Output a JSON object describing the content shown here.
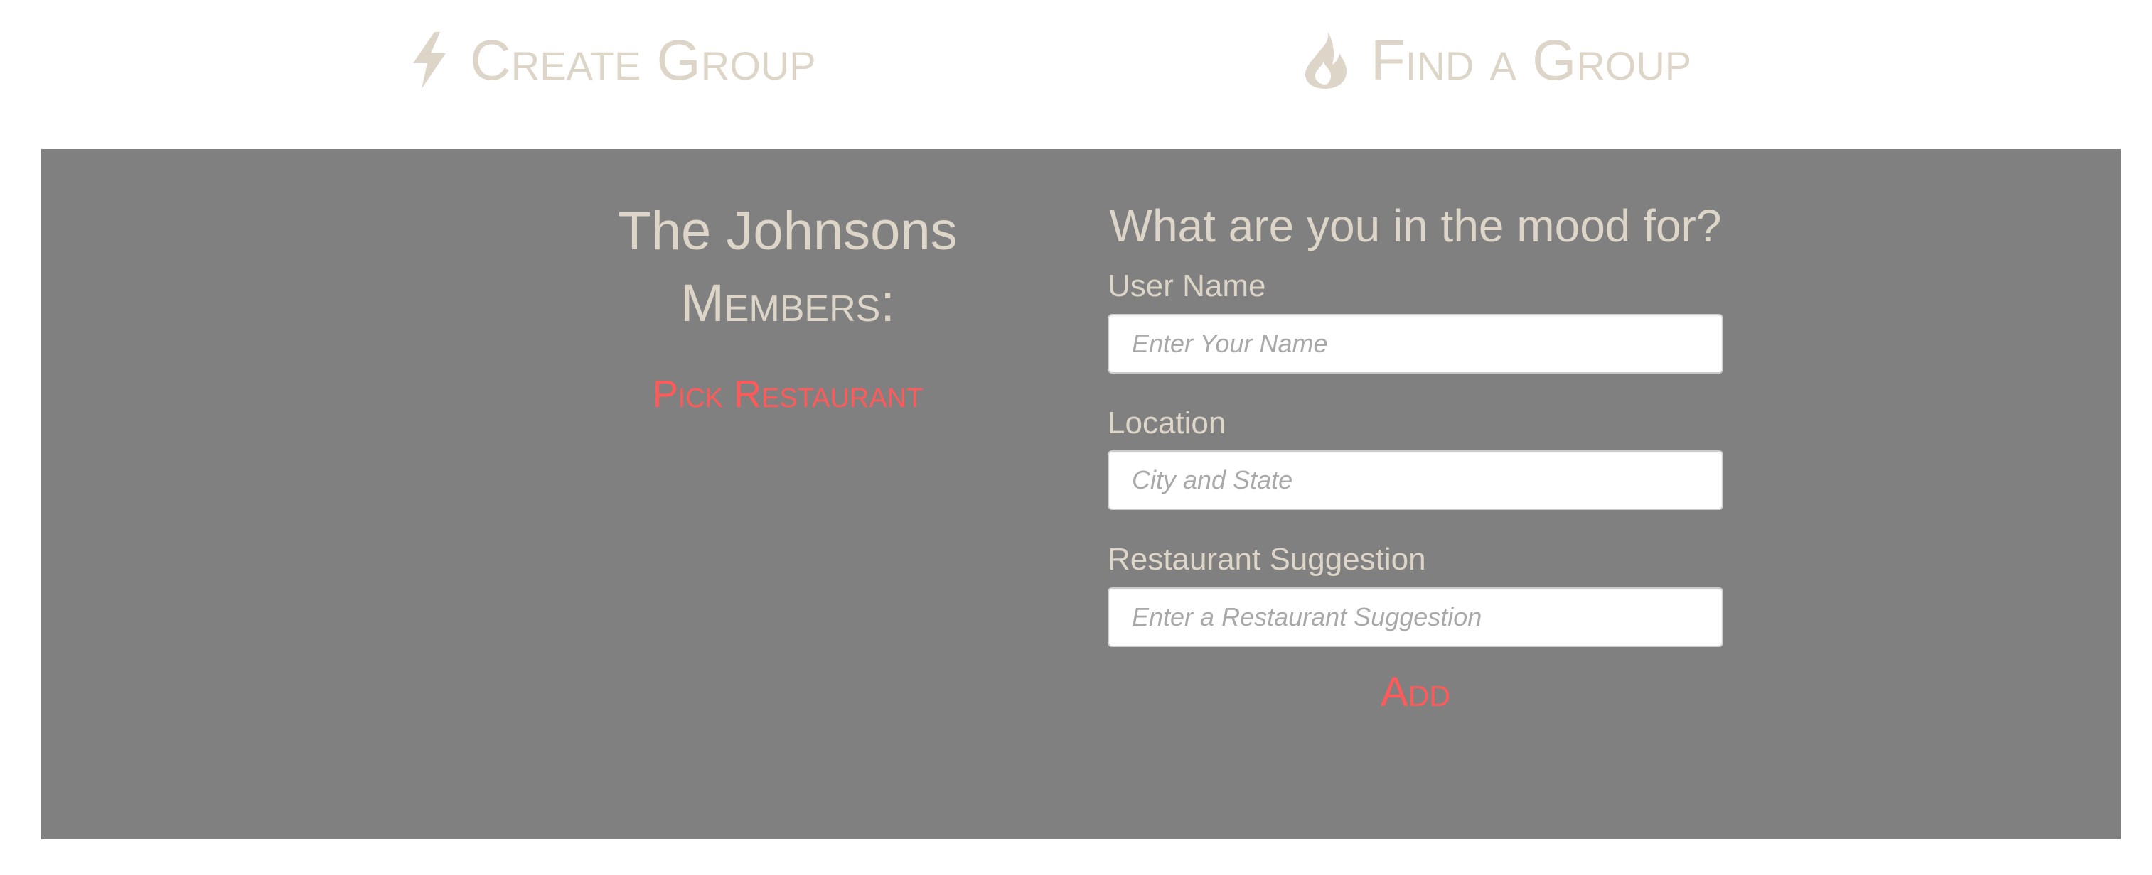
{
  "nav": {
    "create_group": {
      "label": "Create Group",
      "icon": "lightning-bolt-icon"
    },
    "find_group": {
      "label": "Find a Group",
      "icon": "fire-icon"
    }
  },
  "colors": {
    "nav_text": "#ddd5c8",
    "panel_bg": "#808080",
    "accent_red": "#ff5a5a",
    "panel_text": "#ddd5c8"
  },
  "group": {
    "name": "The Johnsons",
    "members_label": "Members:",
    "pick_button": "Pick Restaurant"
  },
  "form": {
    "title": "What are you in the mood for?",
    "user_name": {
      "label": "User Name",
      "value": "",
      "placeholder": "Enter Your Name"
    },
    "location": {
      "label": "Location",
      "value": "",
      "placeholder": "City and State"
    },
    "restaurant": {
      "label": "Restaurant Suggestion",
      "value": "",
      "placeholder": "Enter a Restaurant Suggestion"
    },
    "add_button": "Add"
  }
}
